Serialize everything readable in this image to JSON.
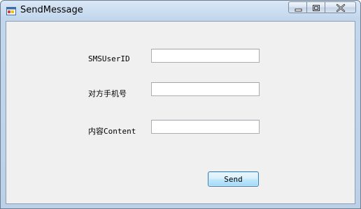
{
  "window": {
    "title": "SendMessage",
    "icon": "windows-form-app-icon",
    "caption_buttons": [
      "minimize",
      "maximize",
      "close"
    ]
  },
  "form": {
    "fields": [
      {
        "label": "SMSUserID",
        "value": "",
        "placeholder": ""
      },
      {
        "label": "对方手机号",
        "value": "",
        "placeholder": ""
      },
      {
        "label": "内容Content",
        "value": "",
        "placeholder": ""
      }
    ],
    "send_label": "Send"
  },
  "colors": {
    "form_background": "#f0f0f0",
    "title_bar": "#c2d6ec",
    "button_border": "#3c7fb1",
    "close_hover": "#c75050"
  }
}
